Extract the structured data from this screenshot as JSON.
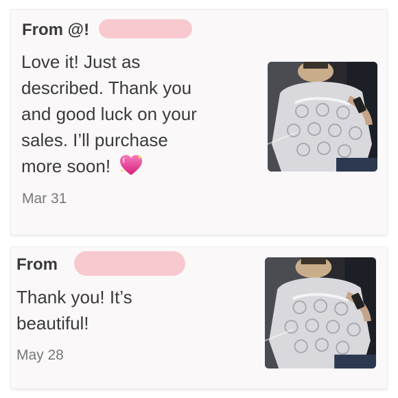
{
  "reviews": [
    {
      "from_label": "From",
      "handle_prefix": "@!",
      "message": "Love it! Just as described. Thank you and good luck on your sales. I’ll purchase more soon!",
      "message_lines": [
        "Love it! Just as",
        "described. Thank you",
        "and good luck on your",
        "sales. I’ll purchase",
        "more soon!"
      ],
      "emoji": "sparkling-heart",
      "date": "Mar 31",
      "thumbnail": "lace-blouse-photo"
    },
    {
      "from_label": "From",
      "handle_prefix": "",
      "message": "Thank you! It’s beautiful!",
      "message_lines": [
        "Thank you! It’s",
        "beautiful!"
      ],
      "date": "May 28",
      "thumbnail": "lace-blouse-photo"
    }
  ],
  "colors": {
    "card_bg": "#fbf8f9",
    "text": "#3a3a3a",
    "date_text": "#777777",
    "redaction": "#f7c9cf",
    "emoji_heart": "#e8358f"
  }
}
